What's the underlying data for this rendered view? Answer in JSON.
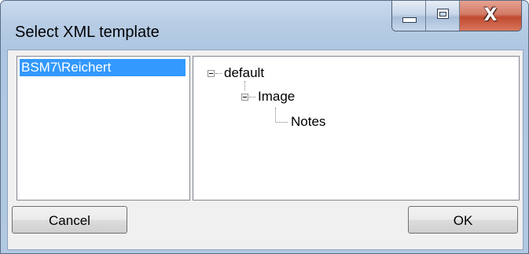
{
  "window": {
    "title": "Select XML template"
  },
  "left_list": {
    "items": [
      "BSM7\\Reichert"
    ],
    "selected": "BSM7\\Reichert"
  },
  "tree": {
    "nodes": [
      {
        "label": "default",
        "level": 0,
        "expanded": true
      },
      {
        "label": "Image",
        "level": 1,
        "expanded": true
      },
      {
        "label": "Notes",
        "level": 2
      }
    ]
  },
  "buttons": {
    "cancel": "Cancel",
    "ok": "OK"
  },
  "icons": {
    "minimize": "minimize-icon",
    "maximize": "maximize-icon",
    "close": "close-icon",
    "close_glyph": "X"
  },
  "colors": {
    "selection": "#3399ff",
    "close_button": "#c04a2f"
  }
}
